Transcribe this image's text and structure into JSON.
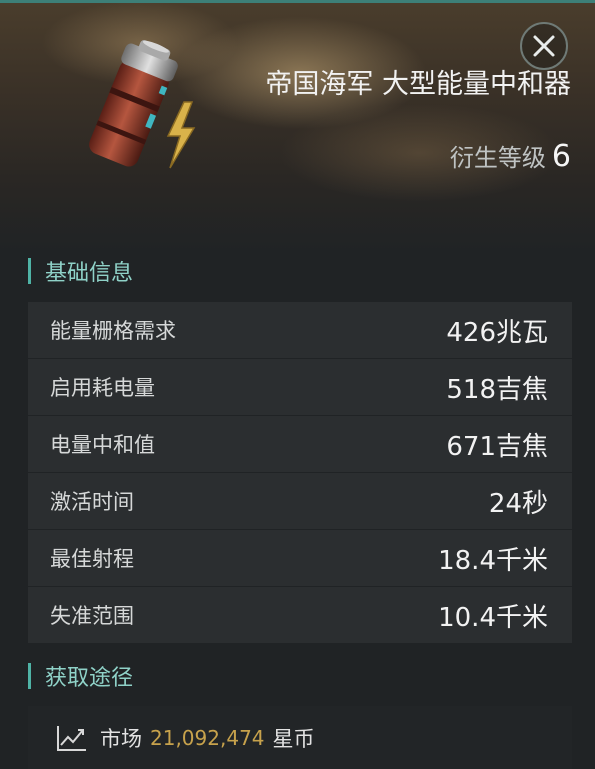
{
  "header": {
    "title": "帝国海军 大型能量中和器",
    "meta_level_label": "衍生等级",
    "meta_level_value": "6"
  },
  "sections": {
    "basic_title": "基础信息",
    "source_title": "获取途径"
  },
  "attributes": [
    {
      "label": "能量栅格需求",
      "value": "426兆瓦"
    },
    {
      "label": "启用耗电量",
      "value": "518吉焦"
    },
    {
      "label": "电量中和值",
      "value": "671吉焦"
    },
    {
      "label": "激活时间",
      "value": "24秒"
    },
    {
      "label": "最佳射程",
      "value": "18.4千米"
    },
    {
      "label": "失准范围",
      "value": "10.4千米"
    }
  ],
  "market": {
    "label": "市场",
    "price": "21,092,474",
    "unit": "星币"
  },
  "icons": {
    "close": "close-icon",
    "item": "energy-neutralizer-icon",
    "market": "chart-trend-icon"
  },
  "colors": {
    "accent": "#4fb3a6",
    "section_text": "#8fd2c8",
    "price": "#c7a24c"
  }
}
